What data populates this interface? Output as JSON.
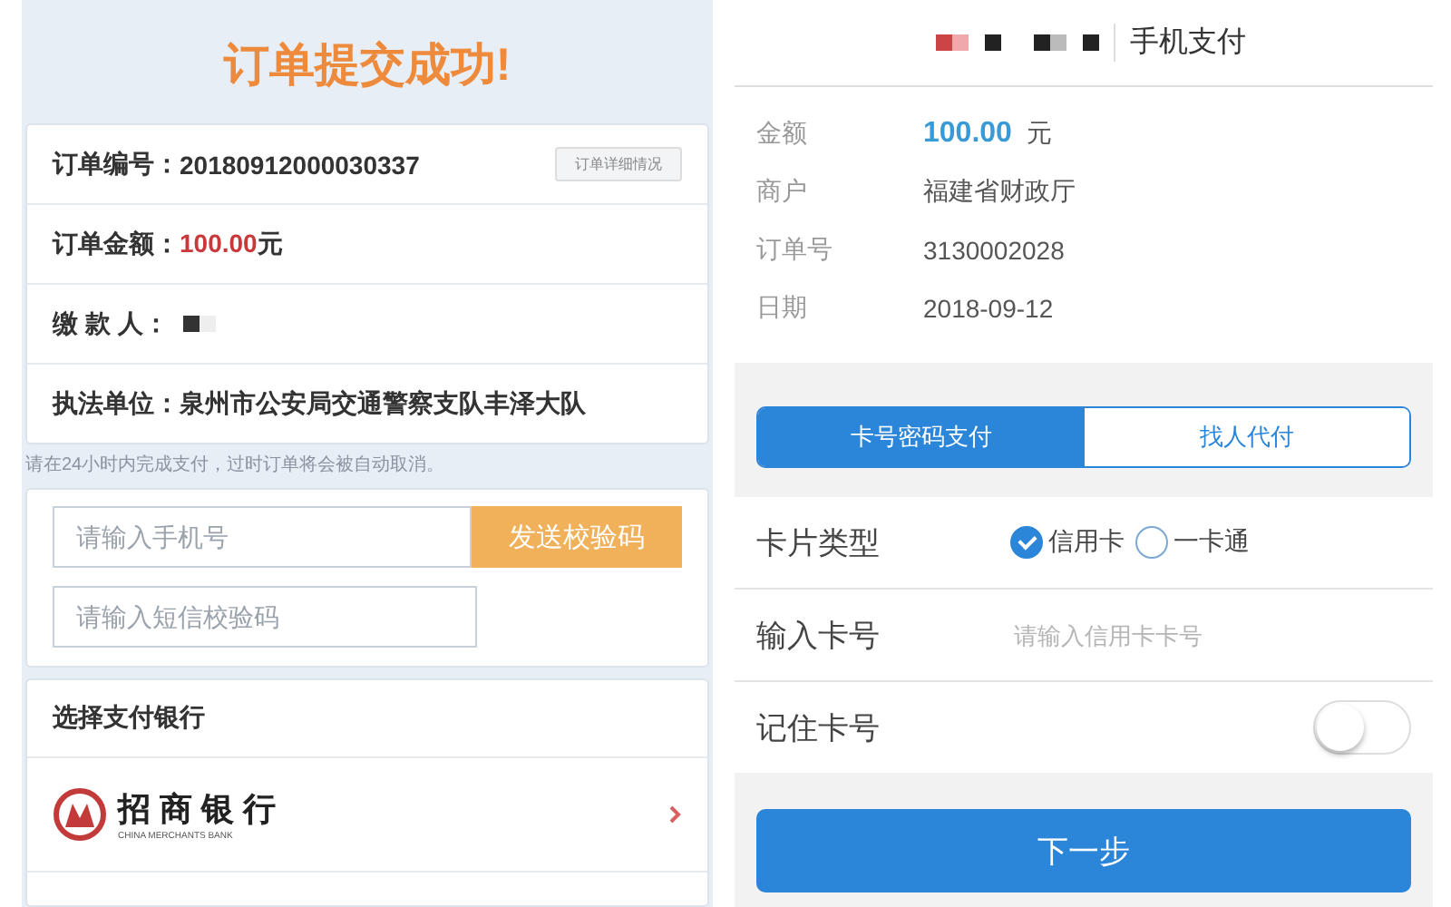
{
  "order_page": {
    "title": "订单提交成功!",
    "rows": [
      {
        "kind": "text",
        "label": "订单编号：",
        "value": "20180912000030337",
        "action": "订单详细情况"
      },
      {
        "kind": "amount",
        "label": "订单金额：",
        "value": "100.00",
        "unit": "元"
      },
      {
        "kind": "redacted",
        "label": "缴 款 人："
      },
      {
        "kind": "text",
        "label": "执法单位：",
        "value": "泉州市公安局交通警察支队丰泽大队"
      }
    ],
    "notice": "请在24小时内完成支付，过时订单将会被自动取消。",
    "phone_field": {
      "placeholder": "请输入手机号"
    },
    "send_code_button": "发送校验码",
    "code_field": {
      "placeholder": "请输入短信校验码"
    },
    "bank_section": {
      "title": "选择支付银行",
      "banks": [
        {
          "name": "招 商 银 行",
          "subtitle": "CHINA MERCHANTS BANK"
        }
      ]
    }
  },
  "payment_page": {
    "title": "手机支付",
    "summary": [
      {
        "kind": "amount",
        "label": "金额",
        "value": "100.00",
        "unit": "元"
      },
      {
        "kind": "text",
        "label": "商户",
        "value": "福建省财政厅"
      },
      {
        "kind": "text",
        "label": "订单号",
        "value": "3130002028"
      },
      {
        "kind": "text",
        "label": "日期",
        "value": "2018-09-12"
      }
    ],
    "tabs": [
      {
        "label": "卡号密码支付",
        "selected": true
      },
      {
        "label": "找人代付",
        "selected": false
      }
    ],
    "card_type": {
      "label": "卡片类型",
      "options": [
        {
          "label": "信用卡",
          "selected": true
        },
        {
          "label": "一卡通",
          "selected": false
        }
      ]
    },
    "card_number": {
      "label": "输入卡号",
      "placeholder": "请输入信用卡卡号"
    },
    "remember_card": {
      "label": "记住卡号",
      "on": false
    },
    "next_button": "下一步"
  }
}
